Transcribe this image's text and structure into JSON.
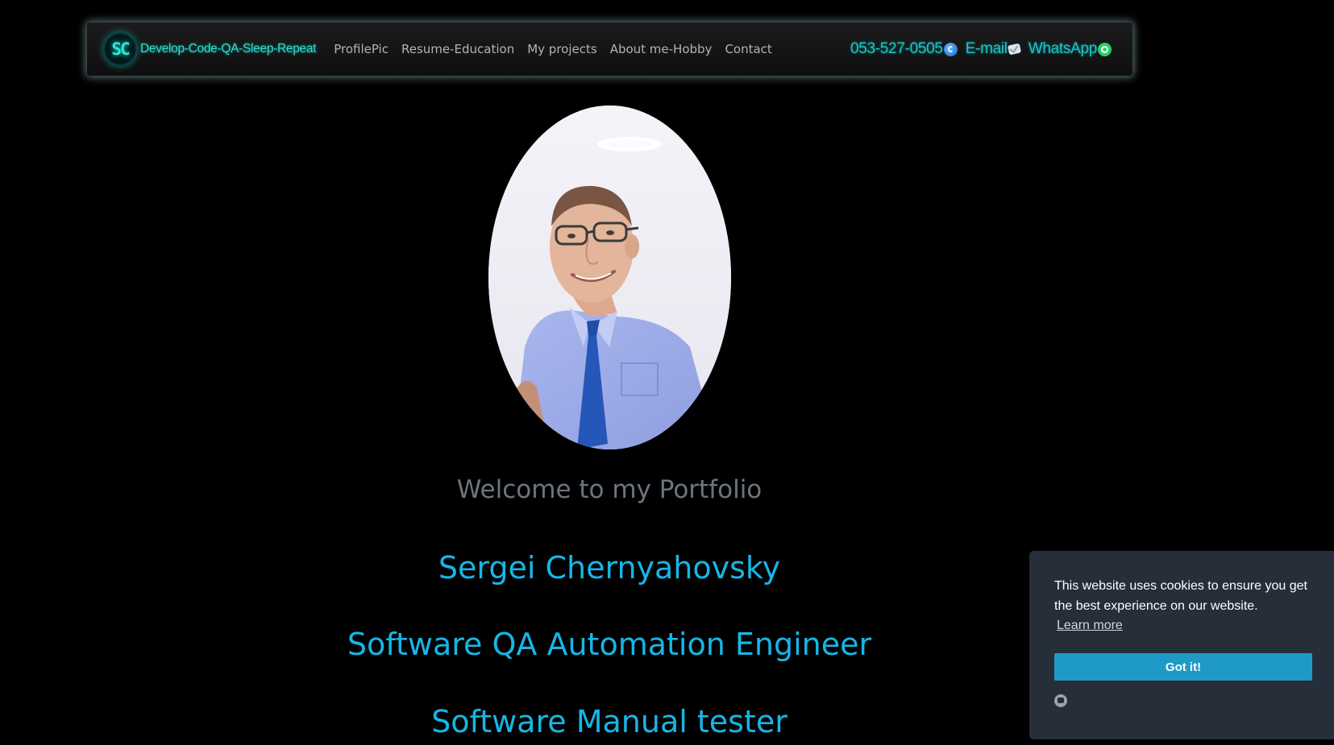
{
  "navbar": {
    "logo_text": "SC",
    "brand": "Develop-Code-QA-Sleep-Repeat",
    "links": [
      {
        "label": "ProfilePic"
      },
      {
        "label": "Resume-Education"
      },
      {
        "label": "My projects"
      },
      {
        "label": "About me-Hobby"
      },
      {
        "label": "Contact"
      }
    ],
    "contact": {
      "phone": "053-527-0505",
      "email": "E-mail",
      "whatsapp": "WhatsApp"
    },
    "accent_color": "#1fc2c6"
  },
  "hero": {
    "welcome": "Welcome to my Portfolio",
    "name": "Sergei Chernyahovsky",
    "title1": "Software QA Automation Engineer",
    "title2": "Software Manual tester",
    "accent_color": "#17b6e6"
  },
  "cookie_banner": {
    "message": "This website uses cookies to ensure you get the best experience on our website.",
    "learn_more": "Learn more",
    "button": "Got it!",
    "button_color": "#1f9ac6"
  },
  "icons": [
    "logo-icon",
    "phone-icon",
    "mail-icon",
    "whatsapp-icon",
    "chat-icon"
  ]
}
